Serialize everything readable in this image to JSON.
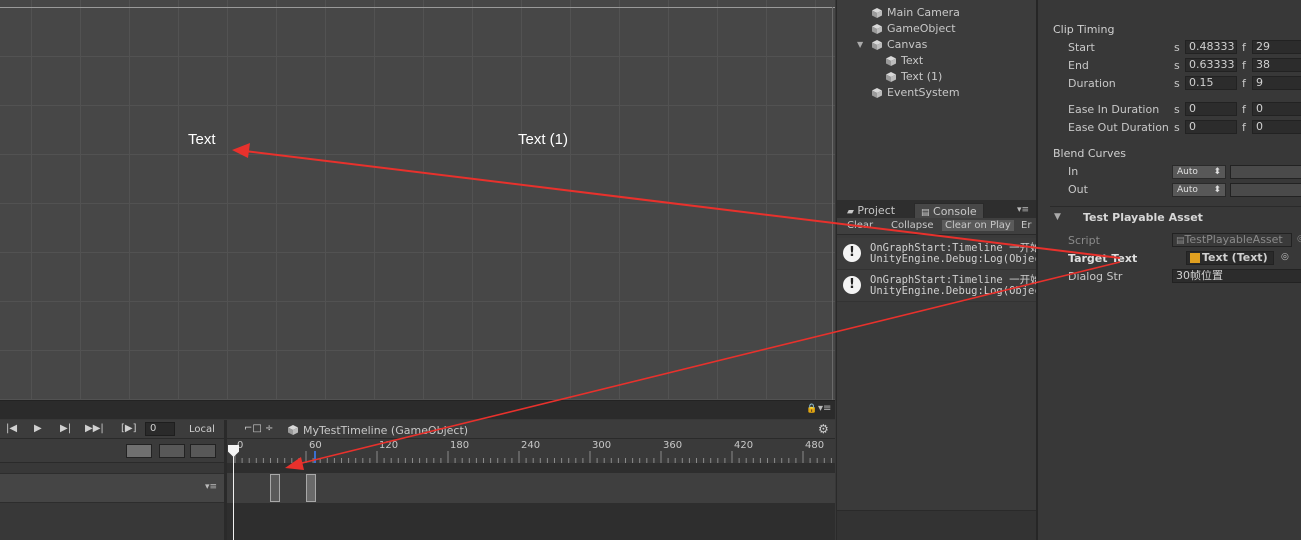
{
  "scene": {
    "labels": [
      "Text",
      "Text (1)"
    ]
  },
  "timeline": {
    "frame": "0",
    "space": "Local",
    "timeline_name": "MyTestTimeline (GameObject)",
    "ruler_ticks": [
      "0",
      "60",
      "120",
      "180",
      "240",
      "300",
      "360",
      "420",
      "480"
    ]
  },
  "hierarchy": {
    "items": [
      {
        "label": "Main Camera"
      },
      {
        "label": "GameObject"
      },
      {
        "label": "Canvas"
      },
      {
        "label": "Text"
      },
      {
        "label": "Text (1)"
      },
      {
        "label": "EventSystem"
      }
    ]
  },
  "console": {
    "tabs": [
      "Project",
      "Console"
    ],
    "toolbar": [
      "Clear",
      "Collapse",
      "Clear on Play",
      "Er"
    ],
    "entries": [
      {
        "line1": "OnGraphStart:Timeline 一开始",
        "line2": "UnityEngine.Debug:Log(Object)"
      },
      {
        "line1": "OnGraphStart:Timeline 一开始",
        "line2": "UnityEngine.Debug:Log(Object)"
      }
    ]
  },
  "inspector": {
    "clip_timing": {
      "title": "Clip Timing",
      "start_label": "Start",
      "start_s": "0.48333",
      "start_f": "29",
      "end_label": "End",
      "end_s": "0.63333",
      "end_f": "38",
      "duration_label": "Duration",
      "duration_s": "0.15",
      "duration_f": "9",
      "ease_in_label": "Ease In Duration",
      "ease_in_s": "0",
      "ease_in_f": "0",
      "ease_out_label": "Ease Out Duration",
      "ease_out_s": "0",
      "ease_out_f": "0",
      "s": "s",
      "f": "f"
    },
    "blend_curves": {
      "title": "Blend Curves",
      "in_label": "In",
      "in_value": "Auto",
      "out_label": "Out",
      "out_value": "Auto"
    },
    "asset": {
      "title": "Test Playable Asset",
      "script_label": "Script",
      "script_value": "TestPlayableAsset",
      "target_label": "Target Text",
      "target_value": "Text (Text)",
      "dialog_label": "Dialog Str",
      "dialog_value": "30帧位置"
    }
  },
  "colors": {
    "arrow": "#e8312c",
    "playhead": "#ffffff"
  }
}
